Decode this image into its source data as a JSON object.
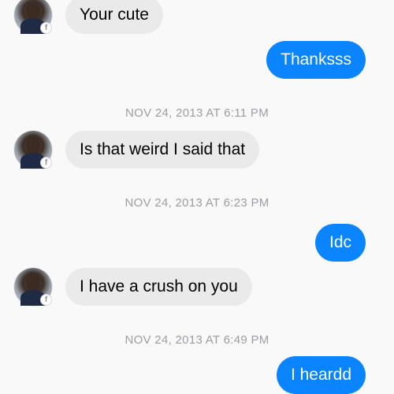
{
  "messages": [
    {
      "from": "contact",
      "text": "Your cute"
    },
    {
      "from": "me",
      "text": "Thanksss"
    },
    {
      "timestamp": "NOV 24, 2013 AT 6:11 PM"
    },
    {
      "from": "contact",
      "text": "Is that weird I said that"
    },
    {
      "timestamp": "NOV 24, 2013 AT 6:23 PM"
    },
    {
      "from": "me",
      "text": "Idc"
    },
    {
      "from": "contact",
      "text": "I have a crush on you"
    },
    {
      "timestamp": "NOV 24, 2013 AT 6:49 PM"
    },
    {
      "from": "me",
      "text": "I heardd"
    }
  ],
  "colors": {
    "incoming_bubble": "#eaeaea",
    "outgoing_bubble": "#0a84ff",
    "timestamp_text": "#9a9ea4",
    "background": "#f9f9f9"
  },
  "icons": {
    "platform_badge": "facebook-badge-icon",
    "badge_glyph": "f"
  }
}
